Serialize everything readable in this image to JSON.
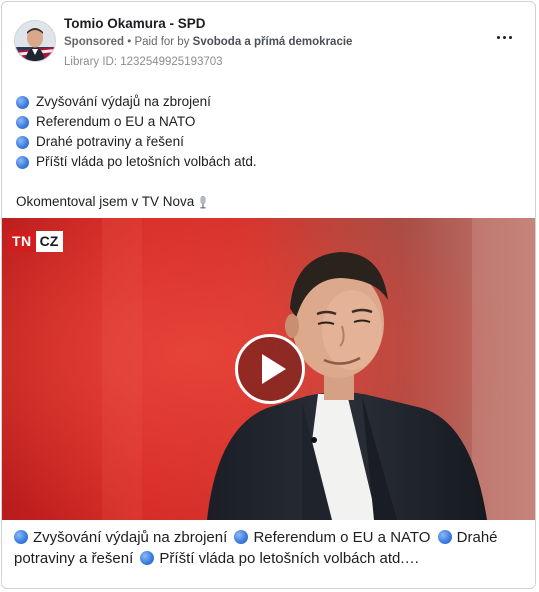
{
  "post": {
    "page_name": "Tomio Okamura - SPD",
    "sponsored": "Sponsored",
    "paid_for_prefix": " • Paid for by ",
    "payer": "Svoboda a přímá demokracie",
    "library_id": "Library ID: 1232549925193703",
    "more_icon": "more-horizontal-icon"
  },
  "body": {
    "bullets": [
      "Zvyšování výdajů na zbrojení",
      "Referendum o EU a NATO",
      "Drahé potraviny a řešení",
      "Příští vláda po letošních volbách atd."
    ],
    "comment": "Okomentoval jsem v TV Nova",
    "comment_icon": "microphone-icon",
    "bullet_icon": "blue-circle-icon"
  },
  "video": {
    "logo_tn": "TN",
    "logo_cz": "CZ",
    "play_icon": "play-icon"
  },
  "caption": {
    "segments": [
      "Zvyšování výdajů na zbrojení",
      "Referendum o EU a NATO",
      "Drahé potraviny a řešení",
      "Příští vláda po letošních volbách atd.…"
    ]
  },
  "colors": {
    "bullet_blue": "#3d7fe0",
    "tn_red": "#d11d1d",
    "meta_gray": "#65676b"
  }
}
